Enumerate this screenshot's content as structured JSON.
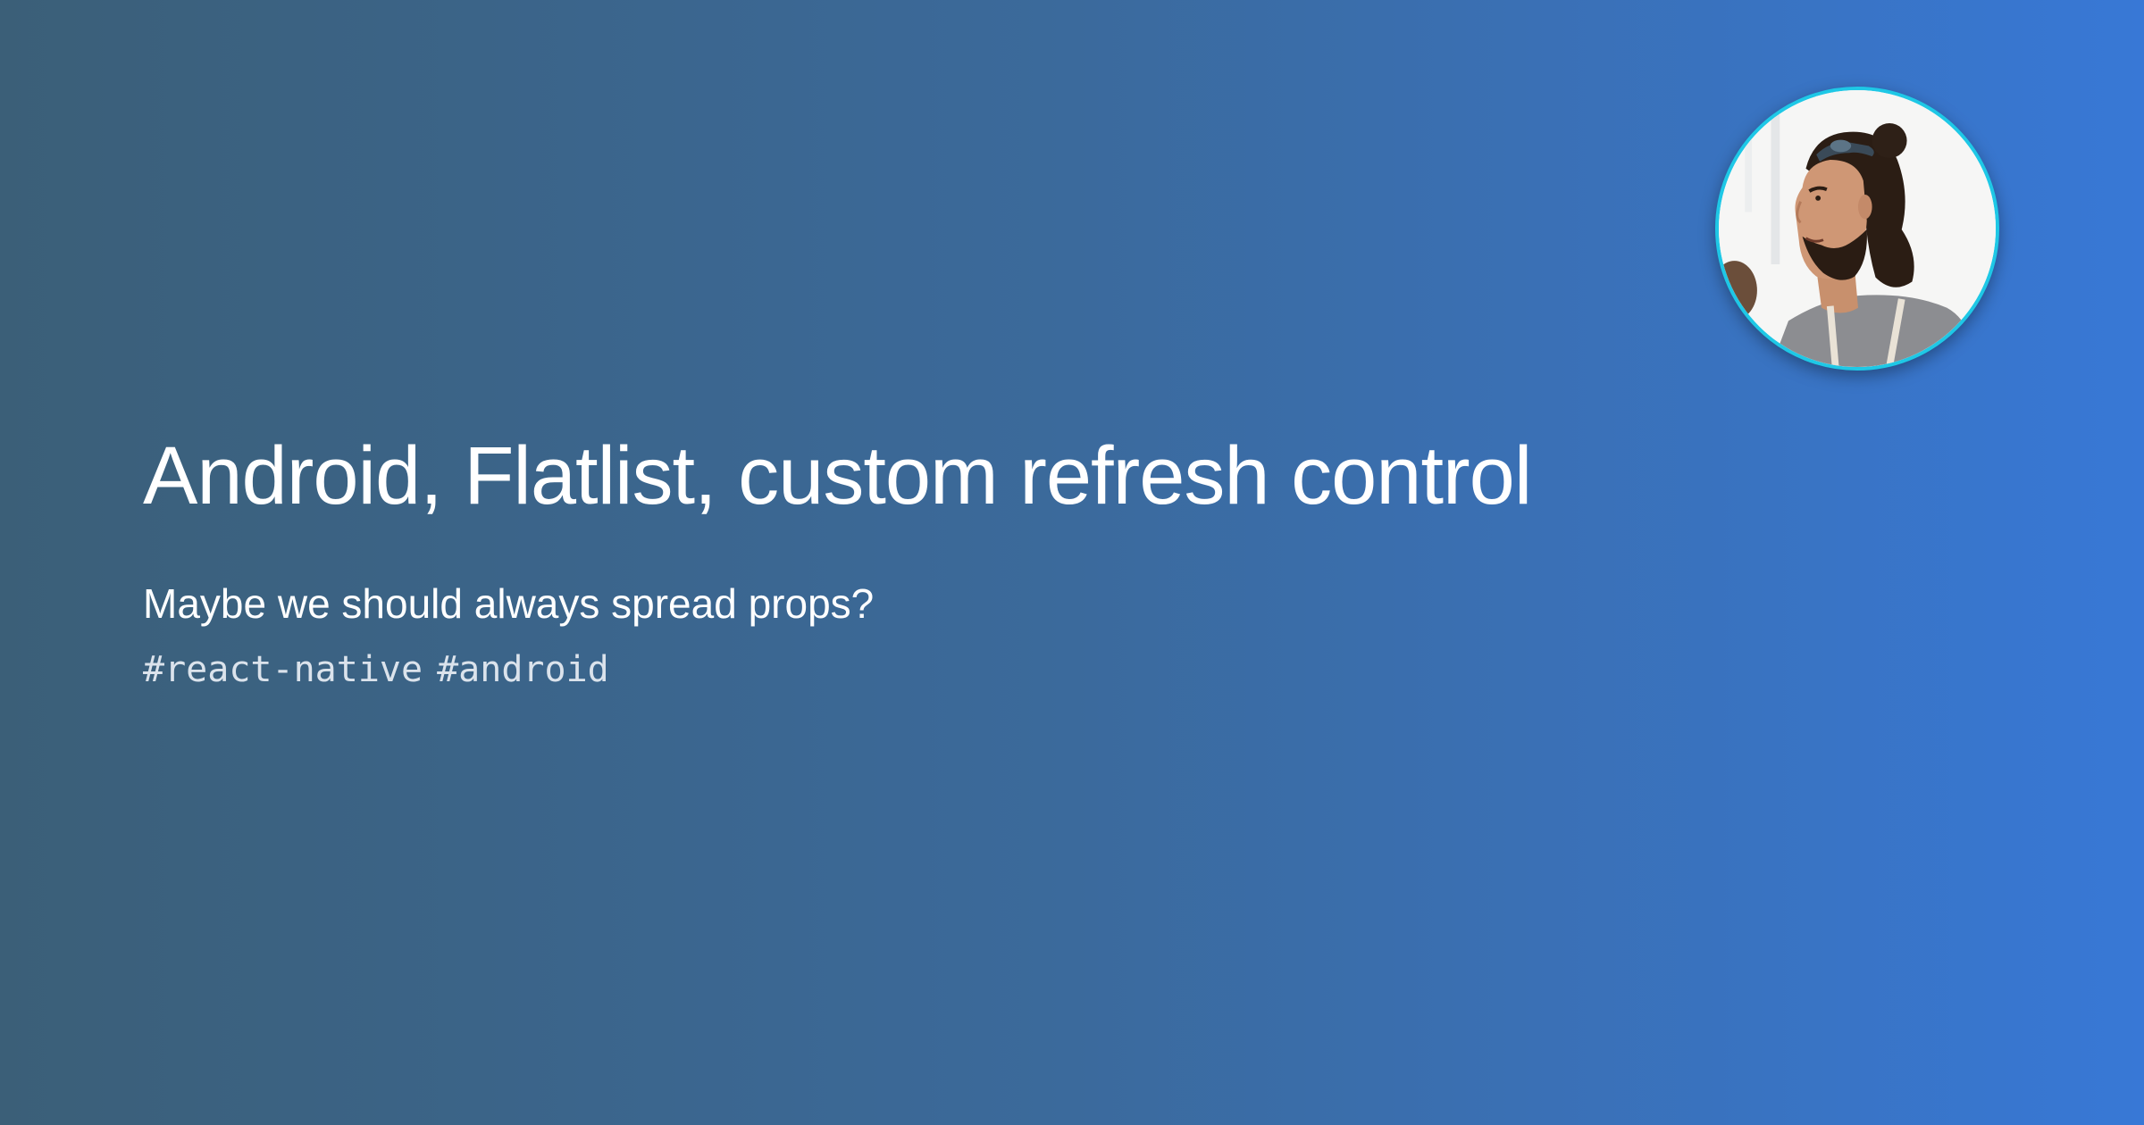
{
  "post": {
    "title": "Android, Flatlist, custom refresh control",
    "subtitle": "Maybe we should always spread props?",
    "tags": [
      "#react-native",
      "#android"
    ]
  },
  "author": {
    "avatar_icon": "author-portrait"
  },
  "colors": {
    "gradient_start": "#3b5f78",
    "gradient_end": "#3878d6",
    "avatar_border": "#1ec8e6",
    "text": "#ffffff",
    "tag_text": "#dbe3ec"
  }
}
